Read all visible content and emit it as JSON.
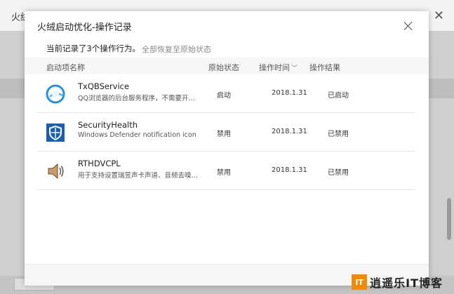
{
  "background_app": {
    "title_fragment": "火绒"
  },
  "dialog": {
    "title": "火绒启动优化-操作记录",
    "summary": "当前记录了3个操作行为。",
    "restore_all_label": "全部恢复至原始状态"
  },
  "table": {
    "columns": [
      "启动项名称",
      "原始状态",
      "操作时间",
      "操作结果"
    ],
    "rows": [
      {
        "name": "TxQBService",
        "description": "QQ浏览器的后台服务程序，不需要开…",
        "original_status": "启动",
        "time": "2018.1.31",
        "result": "已启动",
        "icon": "qq-browser-icon"
      },
      {
        "name": "SecurityHealth",
        "description": "Windows Defender notification icon",
        "original_status": "禁用",
        "time": "2018.1.31",
        "result": "已禁用",
        "icon": "windows-defender-shield-icon"
      },
      {
        "name": "RTHDVCPL",
        "description": "用于支持设置瑞昱声卡声道、音频去噪…",
        "original_status": "禁用",
        "time": "2018.1.31",
        "result": "已禁用",
        "icon": "speaker-icon"
      }
    ]
  },
  "watermark": {
    "badge": "IT",
    "text": "逍遥乐IT博客"
  },
  "colors": {
    "accent_orange": "#f08a00",
    "defender_blue": "#1c5fa8",
    "qq_blue": "#2a8fd9"
  }
}
